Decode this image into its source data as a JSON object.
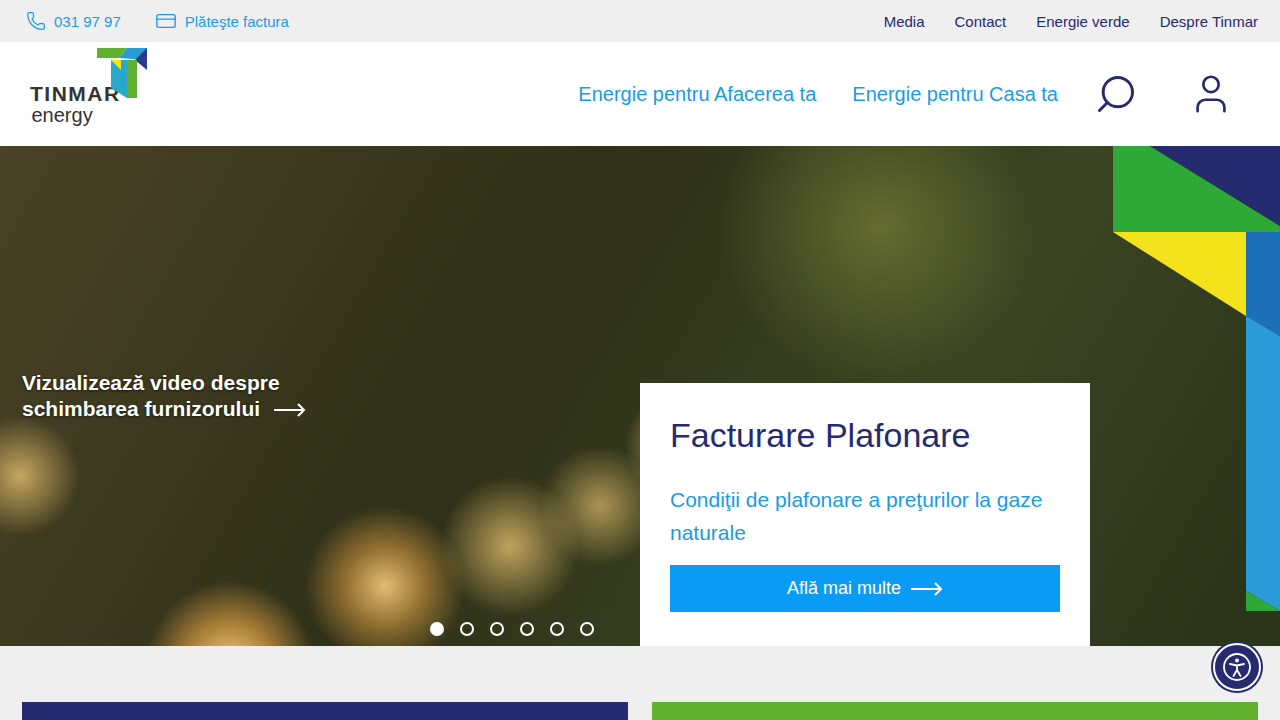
{
  "topbar": {
    "phone": "031 97 97",
    "pay": "Plăteşte factura",
    "links": [
      "Media",
      "Contact",
      "Energie verde",
      "Despre Tinmar"
    ]
  },
  "logo": {
    "name": "TINMAR",
    "sub": "energy"
  },
  "nav": [
    "Energie pentru Afacerea ta",
    "Energie pentru Casa ta"
  ],
  "hero": {
    "video_link": "Vizualizează video despre schimbarea furnizorului",
    "card": {
      "title": "Facturare Plafonare",
      "subtitle": "Condiţii de plafonare a preţurilor la gaze naturale",
      "button": "Află mai multe"
    },
    "slides": [
      {
        "selected": true
      },
      {
        "selected": false
      },
      {
        "selected": false
      },
      {
        "selected": false
      },
      {
        "selected": false
      },
      {
        "selected": false
      }
    ]
  },
  "tiles": [
    {
      "color": "#262a6e"
    },
    {
      "color": "#5fb12f"
    }
  ]
}
